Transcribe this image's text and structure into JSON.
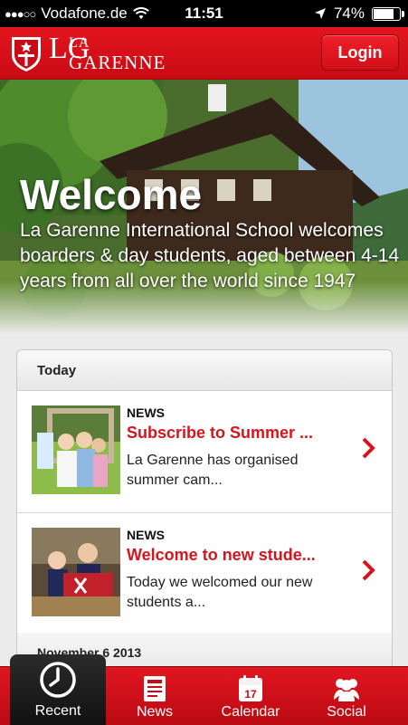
{
  "status_bar": {
    "signal": "●●●○○",
    "carrier": "Vodafone.de",
    "time": "11:51",
    "battery_text": "74%",
    "battery_level": 0.74
  },
  "header": {
    "logo_initials": "LG",
    "logo_line1": "LA",
    "logo_line2": "GARENNE",
    "login_label": "Login"
  },
  "hero": {
    "title": "Welcome",
    "text": "La Garenne International School welcomes boarders & day students, aged between 4-14 years from all over the world since 1947"
  },
  "feed": {
    "section_label": "Today",
    "items": [
      {
        "category": "NEWS",
        "title": "Subscribe to Summer ...",
        "excerpt": "La Garenne has organised summer cam..."
      },
      {
        "category": "NEWS",
        "title": "Welcome to new stude...",
        "excerpt": "Today we welcomed our new students a..."
      }
    ],
    "next_section_label": "November 6 2013"
  },
  "tabs": [
    {
      "label": "Recent",
      "icon": "clock-icon",
      "active": true
    },
    {
      "label": "News",
      "icon": "newspaper-icon",
      "active": false
    },
    {
      "label": "Calendar",
      "icon": "calendar-icon",
      "active": false,
      "calendar_day": "17"
    },
    {
      "label": "Social",
      "icon": "people-icon",
      "active": false
    }
  ],
  "colors": {
    "brand_red": "#d7141c",
    "tab_active": "#1a1a1a"
  }
}
